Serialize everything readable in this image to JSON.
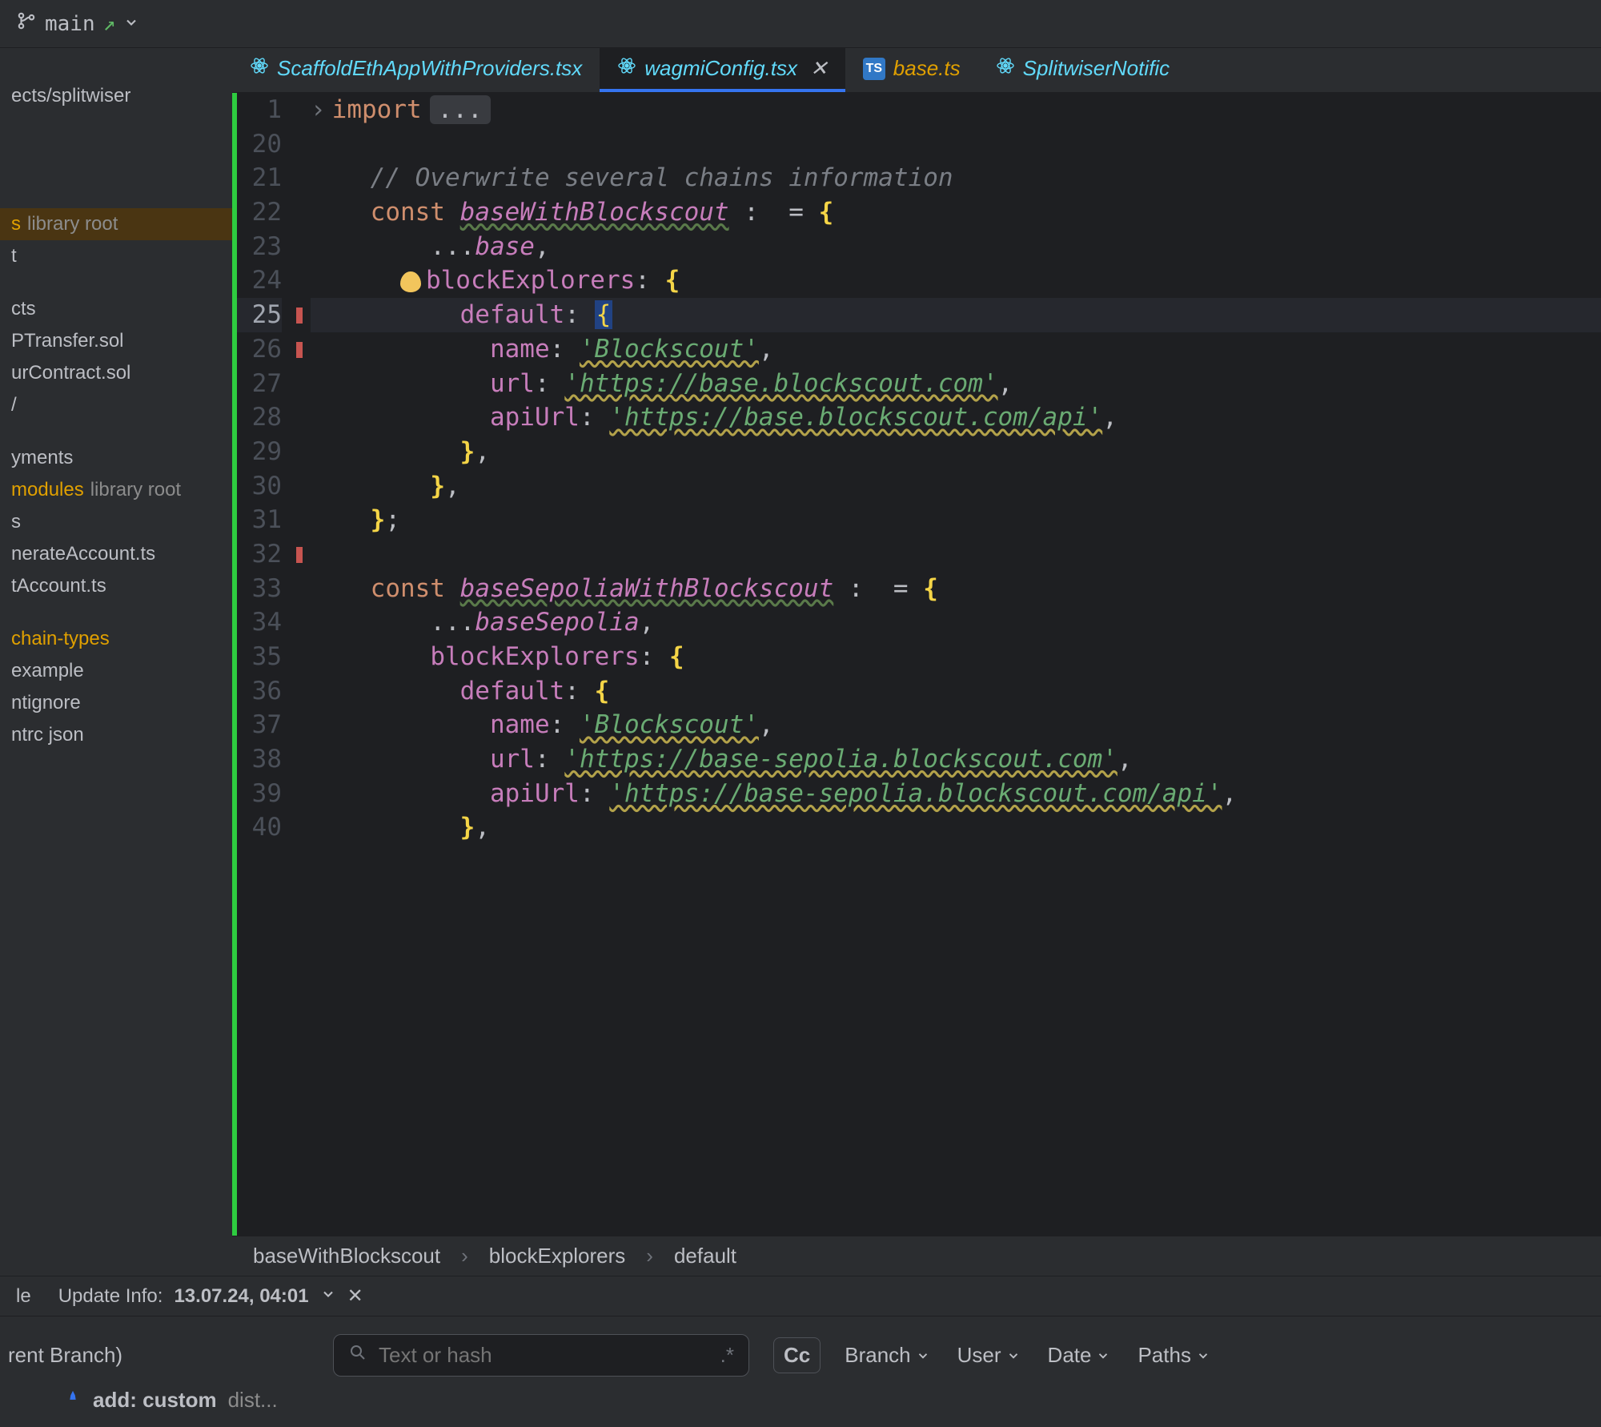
{
  "topbar": {
    "branch_name": "main"
  },
  "sidebar": {
    "items": [
      {
        "label": "ects/splitwiser",
        "kind": "path"
      },
      {
        "label": "s",
        "suffix": "library root",
        "kind": "libroot"
      },
      {
        "label": "t",
        "kind": "plain"
      },
      {
        "label": "cts",
        "kind": "plain"
      },
      {
        "label": "PTransfer.sol",
        "kind": "plain"
      },
      {
        "label": "urContract.sol",
        "kind": "plain"
      },
      {
        "label": "/",
        "kind": "plain"
      },
      {
        "label": "yments",
        "kind": "plain"
      },
      {
        "label": "modules",
        "suffix": "library root",
        "kind": "nodemods"
      },
      {
        "label": "s",
        "kind": "plain"
      },
      {
        "label": "nerateAccount.ts",
        "kind": "plain"
      },
      {
        "label": "tAccount.ts",
        "kind": "plain"
      },
      {
        "label": "chain-types",
        "kind": "chain"
      },
      {
        "label": "example",
        "kind": "plain"
      },
      {
        "label": "ntignore",
        "kind": "plain"
      },
      {
        "label": "ntrc json",
        "kind": "plain"
      }
    ]
  },
  "tabs": [
    {
      "label": "ScaffoldEthAppWithProviders.tsx",
      "icon": "react",
      "active": false
    },
    {
      "label": "wagmiConfig.tsx",
      "icon": "react",
      "active": true,
      "closeable": true
    },
    {
      "label": "base.ts",
      "icon": "ts",
      "active": false
    },
    {
      "label": "SplitwiserNotific",
      "icon": "react",
      "active": false
    }
  ],
  "code": {
    "lines": [
      {
        "n": 1,
        "parts": [
          {
            "t": "fold",
            "v": "›"
          },
          {
            "t": "kw",
            "v": "import"
          },
          {
            "t": "dots",
            "v": "..."
          }
        ]
      },
      {
        "n": 20,
        "parts": []
      },
      {
        "n": 21,
        "parts": [
          {
            "t": "cmnt",
            "v": "// Overwrite several chains information"
          }
        ],
        "indent": 2
      },
      {
        "n": 22,
        "parts": [
          {
            "t": "kw",
            "v": "const"
          },
          {
            "t": "sp"
          },
          {
            "t": "ident",
            "v": "baseWithBlockscout"
          },
          {
            "t": "punc",
            "v": " :  = "
          },
          {
            "t": "brace",
            "v": "{"
          }
        ],
        "indent": 2
      },
      {
        "n": 23,
        "parts": [
          {
            "t": "punc",
            "v": "..."
          },
          {
            "t": "ident-plain",
            "v": "base"
          },
          {
            "t": "punc",
            "v": ","
          }
        ],
        "indent": 4
      },
      {
        "n": 24,
        "parts": [
          {
            "t": "bulb"
          },
          {
            "t": "prop",
            "v": "blockExplorers"
          },
          {
            "t": "colon",
            "v": ": "
          },
          {
            "t": "brace",
            "v": "{"
          }
        ],
        "indent": 3
      },
      {
        "n": 25,
        "current": true,
        "mark": true,
        "parts": [
          {
            "t": "prop",
            "v": "default"
          },
          {
            "t": "colon",
            "v": ": "
          },
          {
            "t": "cursorbrace",
            "v": "{"
          }
        ],
        "indent": 5
      },
      {
        "n": 26,
        "mark": true,
        "parts": [
          {
            "t": "prop",
            "v": "name"
          },
          {
            "t": "colon",
            "v": ": "
          },
          {
            "t": "str",
            "v": "'Blockscout'"
          },
          {
            "t": "punc",
            "v": ","
          }
        ],
        "indent": 6
      },
      {
        "n": 27,
        "parts": [
          {
            "t": "prop",
            "v": "url"
          },
          {
            "t": "colon",
            "v": ": "
          },
          {
            "t": "str",
            "v": "'https://base.blockscout.com'"
          },
          {
            "t": "punc",
            "v": ","
          }
        ],
        "indent": 6
      },
      {
        "n": 28,
        "parts": [
          {
            "t": "prop",
            "v": "apiUrl"
          },
          {
            "t": "colon",
            "v": ": "
          },
          {
            "t": "str",
            "v": "'https://base.blockscout.com/api'"
          },
          {
            "t": "punc",
            "v": ","
          }
        ],
        "indent": 6
      },
      {
        "n": 29,
        "parts": [
          {
            "t": "brace",
            "v": "}"
          },
          {
            "t": "punc",
            "v": ","
          }
        ],
        "indent": 5
      },
      {
        "n": 30,
        "parts": [
          {
            "t": "brace",
            "v": "}"
          },
          {
            "t": "punc",
            "v": ","
          }
        ],
        "indent": 4
      },
      {
        "n": 31,
        "parts": [
          {
            "t": "brace",
            "v": "}"
          },
          {
            "t": "punc",
            "v": ";"
          }
        ],
        "indent": 2
      },
      {
        "n": 32,
        "mark": true,
        "parts": []
      },
      {
        "n": 33,
        "parts": [
          {
            "t": "kw",
            "v": "const"
          },
          {
            "t": "sp"
          },
          {
            "t": "ident",
            "v": "baseSepoliaWithBlockscout"
          },
          {
            "t": "punc",
            "v": " :  = "
          },
          {
            "t": "brace",
            "v": "{"
          }
        ],
        "indent": 2
      },
      {
        "n": 34,
        "parts": [
          {
            "t": "punc",
            "v": "..."
          },
          {
            "t": "ident-plain",
            "v": "baseSepolia"
          },
          {
            "t": "punc",
            "v": ","
          }
        ],
        "indent": 4
      },
      {
        "n": 35,
        "parts": [
          {
            "t": "prop",
            "v": "blockExplorers"
          },
          {
            "t": "colon",
            "v": ": "
          },
          {
            "t": "brace",
            "v": "{"
          }
        ],
        "indent": 4
      },
      {
        "n": 36,
        "parts": [
          {
            "t": "prop",
            "v": "default"
          },
          {
            "t": "colon",
            "v": ": "
          },
          {
            "t": "brace",
            "v": "{"
          }
        ],
        "indent": 5
      },
      {
        "n": 37,
        "parts": [
          {
            "t": "prop",
            "v": "name"
          },
          {
            "t": "colon",
            "v": ": "
          },
          {
            "t": "str",
            "v": "'Blockscout'"
          },
          {
            "t": "punc",
            "v": ","
          }
        ],
        "indent": 6
      },
      {
        "n": 38,
        "parts": [
          {
            "t": "prop",
            "v": "url"
          },
          {
            "t": "colon",
            "v": ": "
          },
          {
            "t": "str",
            "v": "'https://base-sepolia.blockscout.com'"
          },
          {
            "t": "punc",
            "v": ","
          }
        ],
        "indent": 6
      },
      {
        "n": 39,
        "parts": [
          {
            "t": "prop",
            "v": "apiUrl"
          },
          {
            "t": "colon",
            "v": ": "
          },
          {
            "t": "str",
            "v": "'https://base-sepolia.blockscout.com/api'"
          },
          {
            "t": "punc",
            "v": ","
          }
        ],
        "indent": 6
      },
      {
        "n": 40,
        "parts": [
          {
            "t": "brace",
            "v": "}"
          },
          {
            "t": "punc",
            "v": ","
          }
        ],
        "indent": 5
      }
    ]
  },
  "breadcrumb": {
    "parts": [
      "baseWithBlockscout",
      "blockExplorers",
      "default"
    ]
  },
  "status": {
    "update_info_label": "Update Info:",
    "update_info_value": "13.07.24, 04:01",
    "left_label": "le",
    "bottom_left": "rent Branch)"
  },
  "bottom": {
    "search_placeholder": "Text or hash",
    "cc_label": "Cc",
    "filters": [
      "Branch",
      "User",
      "Date",
      "Paths"
    ],
    "commit_msg": "add: custom",
    "commit_rest": " dist..."
  }
}
